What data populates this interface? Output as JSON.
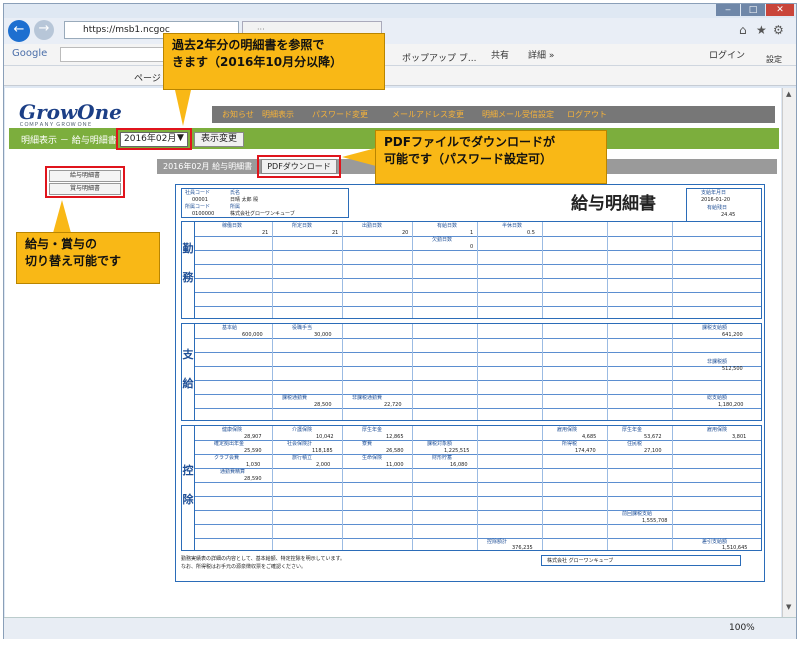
{
  "browser": {
    "url": "https://msb1.ncgoc",
    "zoom": "100%",
    "google": "Google",
    "popup": "ポップアップ ブ...",
    "share": "共有",
    "detail": "詳細 »",
    "login": "ログイン",
    "settings": "設定",
    "page_label": "ページ"
  },
  "site": {
    "logo": "GrowOne",
    "logo_sub": "ＣＯＭＰＡＮＹ ＧＲＯＷ ＯＮＥ",
    "nav": [
      "お知らせ",
      "明細表示",
      "パスワード変更",
      "メールアドレス変更",
      "明細メール受信設定",
      "ログアウト"
    ]
  },
  "toolbar": {
    "breadcrumb": "明細表示 － 給与明細書",
    "select_value": "2016年02月",
    "view_button": "表示変更",
    "tab_label": "2016年02月 給与明細書",
    "pdf_button": "PDFダウンロード",
    "left_buttons": [
      "給与明細書",
      "賞与明細書"
    ]
  },
  "slip": {
    "title": "給与明細書",
    "emp_no_label": "社員コード",
    "emp_no": "00001",
    "name_label": "氏名",
    "name": "日晴 太郎 殿",
    "dept_code_label": "所属コード",
    "dept_code": "0100000",
    "dept_label": "所属",
    "dept": "株式会社グローワンキューブ",
    "pay_date_label": "支給年月日",
    "pay_date": "2016-01-20",
    "allow_label": "有給残日",
    "allow": "24.45",
    "attendance": {
      "label": [
        "勤",
        "務"
      ],
      "headers": [
        "稼働日数",
        "所定日数",
        "出勤日数",
        "有給日数",
        "半休日数"
      ],
      "values": [
        "21",
        "21",
        "20",
        "1",
        "0.5"
      ],
      "sub_label": "欠勤日数",
      "sub_value": "0"
    },
    "payment": {
      "label": [
        "支",
        "給"
      ],
      "items": [
        {
          "k": "基本給",
          "v": "600,000"
        },
        {
          "k": "役職手当",
          "v": "30,000"
        },
        {
          "k": "課税通勤費",
          "v": "28,500"
        },
        {
          "k": "非課税通勤費",
          "v": "22,720"
        }
      ],
      "right": [
        {
          "k": "課税支給額",
          "v": "641,200"
        },
        {
          "k": "非課税額",
          "v": "512,500"
        },
        {
          "k": "総支給額",
          "v": "1,180,200"
        }
      ]
    },
    "deduction": {
      "label": [
        "控",
        "除"
      ],
      "items": [
        {
          "k": "健康保険",
          "v": "28,907"
        },
        {
          "k": "介護保険",
          "v": "10,042"
        },
        {
          "k": "厚生年金",
          "v": "12,865"
        },
        {
          "k": "雇用保険",
          "v": "4,685"
        },
        {
          "k": "厚生年金",
          "v": "53,672"
        },
        {
          "k": "雇用保険",
          "v": "3,801"
        },
        {
          "k": "確定拠出年金",
          "v": "25,590"
        },
        {
          "k": "社会保険計",
          "v": "118,185"
        },
        {
          "k": "寮費",
          "v": "26,580"
        },
        {
          "k": "課税対象額",
          "v": "1,225,515"
        },
        {
          "k": "所得税",
          "v": "174,470"
        },
        {
          "k": "住民税",
          "v": "27,100"
        },
        {
          "k": "クラブ会費",
          "v": "1,030"
        },
        {
          "k": "旅行積立",
          "v": "2,000"
        },
        {
          "k": "生命保険",
          "v": "11,000"
        },
        {
          "k": "財形貯蓄",
          "v": "16,080"
        },
        {
          "k": "通勤費精算",
          "v": "28,590"
        }
      ],
      "sub_total_label": "控除額計",
      "sub_total": "376,235",
      "net_label": "差引支給額",
      "net": "1,510,645",
      "extra_label": "前回課税支給",
      "extra": "1,555,708"
    },
    "footer_note1": "勤務実績表の詳細の内容として、基本給額、特定控除を明示しています。",
    "footer_note2": "なお、所得税はお手元の源泉徴収票をご確認ください。",
    "company": "株式会社 グローワンキューブ"
  },
  "callouts": {
    "top": [
      "過去2年分の明細書を参照で",
      "きます（2016年10月分以降）"
    ],
    "pdf": [
      "PDFファイルでダウンロードが",
      "可能です（パスワード設定可）"
    ],
    "left": [
      "給与・賞与の",
      "切り替え可能です"
    ]
  }
}
